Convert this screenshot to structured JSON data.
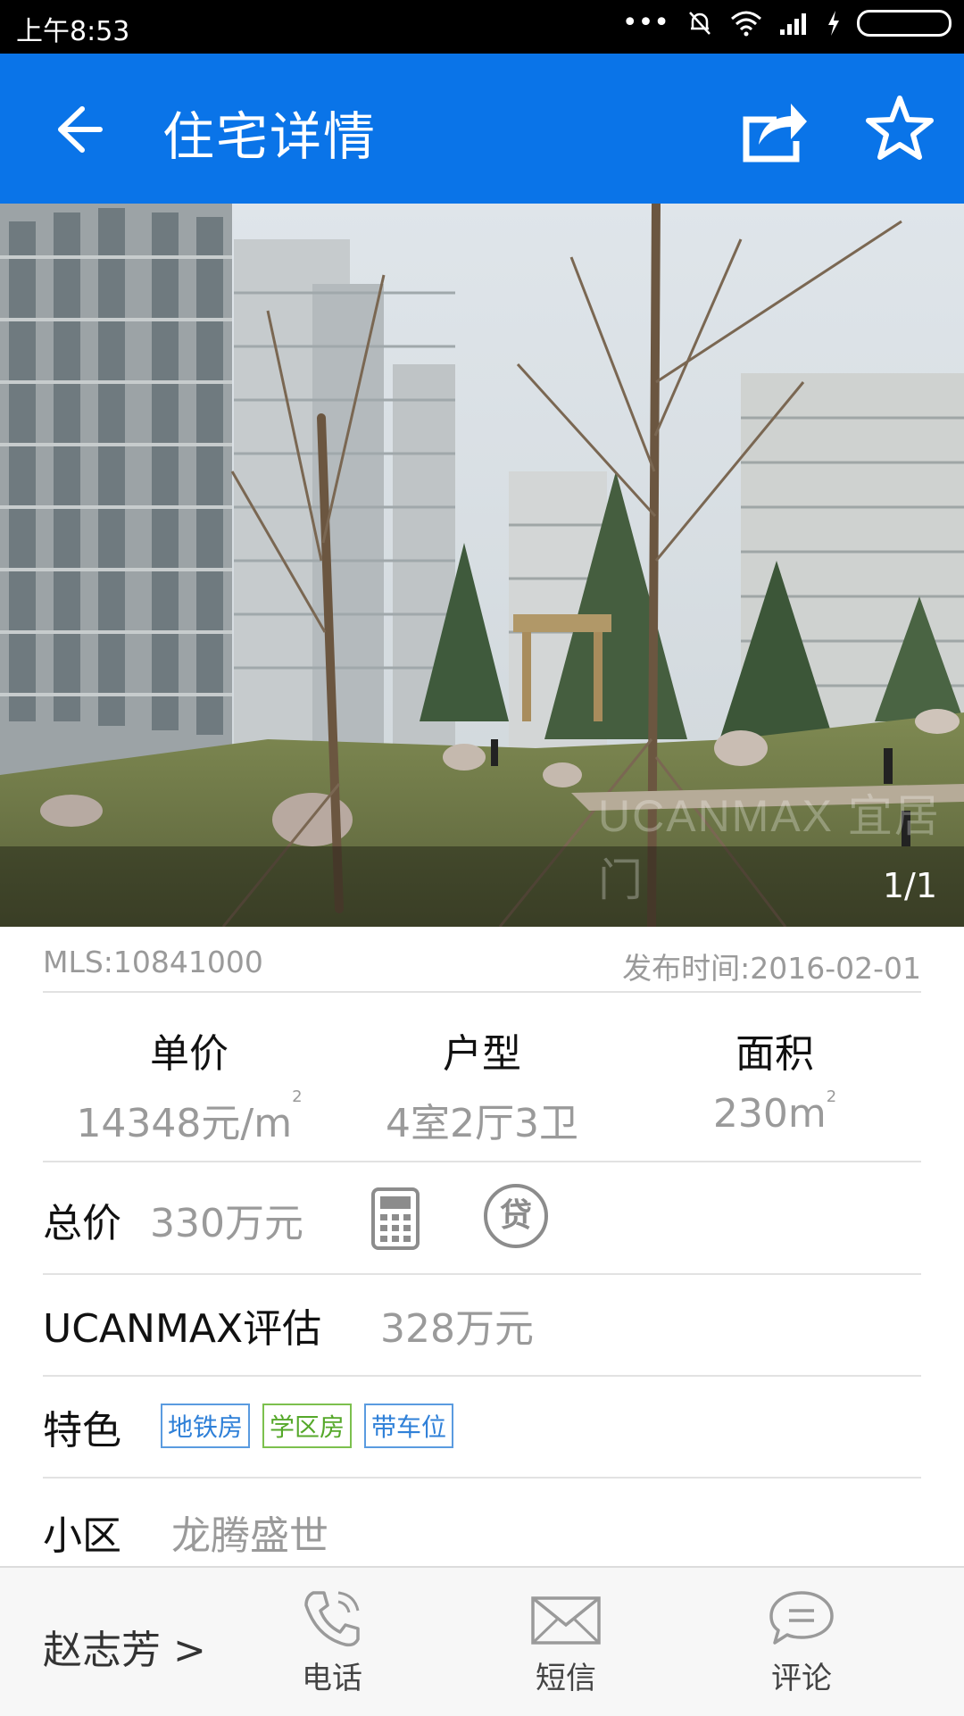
{
  "status_bar": {
    "time": "上午8:53"
  },
  "app_bar": {
    "title": "住宅详情"
  },
  "photo": {
    "counter": "1/1",
    "watermark": "UCANMAX 宜居门"
  },
  "meta": {
    "mls": "MLS:10841000",
    "published": "发布时间:2016-02-01"
  },
  "stats": [
    {
      "label": "单价",
      "value": "14348元/m",
      "sup": "2"
    },
    {
      "label": "户型",
      "value": "4室2厅3卫",
      "sup": ""
    },
    {
      "label": "面积",
      "value": "230m",
      "sup": "2"
    }
  ],
  "total_price": {
    "label": "总价",
    "value": "330万元",
    "loan_icon_text": "贷"
  },
  "valuation": {
    "label": "UCANMAX评估",
    "value": "328万元"
  },
  "features": {
    "label": "特色",
    "tags": [
      "地铁房",
      "学区房",
      "带车位"
    ]
  },
  "community": {
    "label": "小区",
    "value": "龙腾盛世"
  },
  "bottom_bar": {
    "agent": "赵志芳 >",
    "actions": [
      "电话",
      "短信",
      "评论"
    ]
  }
}
